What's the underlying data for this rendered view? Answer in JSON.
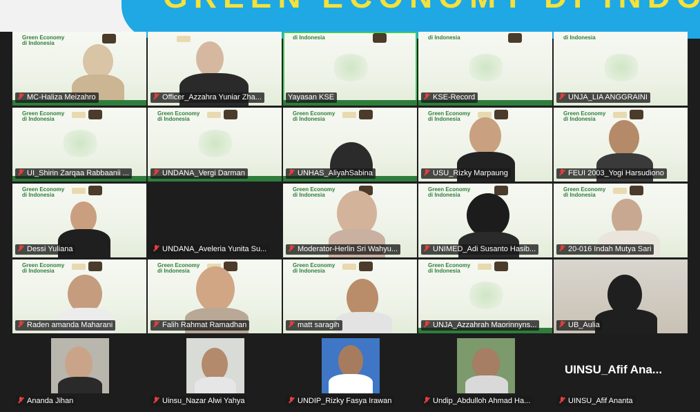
{
  "banner": {
    "title": "GREEN ECONOMY DI INDO"
  },
  "slide": {
    "logo_line1": "Green Economy",
    "logo_line2": "di Indonesia"
  },
  "colors": {
    "banner_bg": "#1fa8e4",
    "banner_text": "#f5e13a",
    "muted_mic": "#e0403a",
    "active_border": "#3ecf5a"
  },
  "participants": [
    {
      "name": "MC-Haliza Meizahro",
      "muted": true
    },
    {
      "name": "Officer_Azzahra Yuniar Zha...",
      "muted": true
    },
    {
      "name": "Yayasan KSE",
      "muted": false
    },
    {
      "name": "KSE-Record",
      "muted": true
    },
    {
      "name": "UNJA_LIA ANGGRAINI",
      "muted": true
    },
    {
      "name": "UI_Shirin Zarqaa Rabbaanii ...",
      "muted": true
    },
    {
      "name": "UNDANA_Vergi Darman",
      "muted": true
    },
    {
      "name": "UNHAS_AliyahSabina",
      "muted": true
    },
    {
      "name": "USU_Rizky Marpaung",
      "muted": true
    },
    {
      "name": "FEUI 2003_Yogi Harsudiono",
      "muted": true
    },
    {
      "name": "Dessi Yuliana",
      "muted": true
    },
    {
      "name": "UNDANA_Aveleria Yunita Su...",
      "muted": true
    },
    {
      "name": "Moderator-Herlin Sri Wahyu...",
      "muted": true
    },
    {
      "name": "UNIMED_Adi Susanto Hasib...",
      "muted": true
    },
    {
      "name": "20-016 Indah Mutya Sari",
      "muted": true
    },
    {
      "name": "Raden amanda Maharani",
      "muted": true
    },
    {
      "name": "Falih Rahmat Ramadhan",
      "muted": true
    },
    {
      "name": "matt saragih",
      "muted": true
    },
    {
      "name": "UNJA_Azzahrah Maorinnyns...",
      "muted": true
    },
    {
      "name": "UB_Aulia",
      "muted": true
    },
    {
      "name": "Ananda Jihan",
      "muted": true
    },
    {
      "name": "Uinsu_Nazar Alwi Yahya",
      "muted": true
    },
    {
      "name": "UNDIP_Rizky Fasya Irawan",
      "muted": true
    },
    {
      "name": "Undip_Abdulloh Ahmad Ha...",
      "muted": true
    },
    {
      "name": "UINSU_Afif Ananta",
      "muted": true
    }
  ],
  "camera_off": {
    "display_name": "UINSU_Afif Ana..."
  }
}
